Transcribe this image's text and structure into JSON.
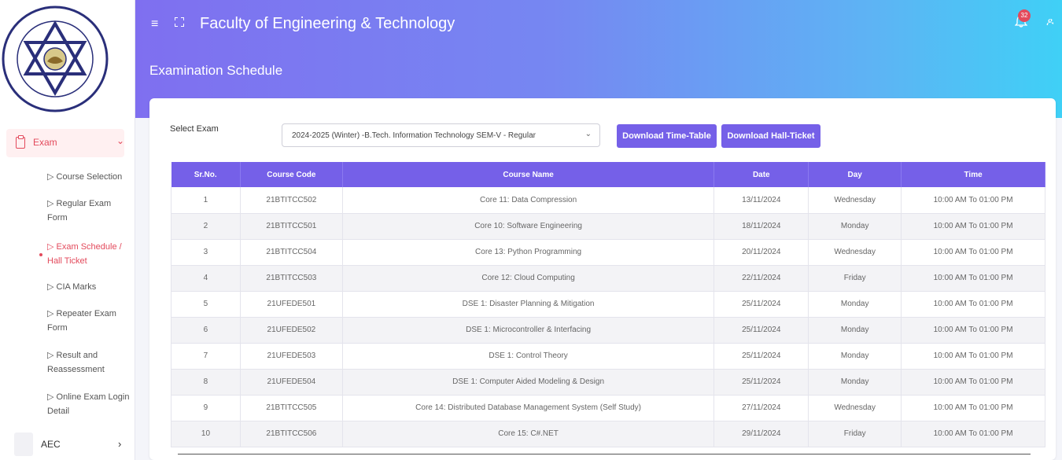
{
  "header": {
    "title": "Faculty of Engineering & Technology",
    "page_title": "Examination Schedule",
    "notification_count": "32"
  },
  "sidebar": {
    "exam_label": "Exam",
    "items": [
      {
        "label": "▷ Course Selection"
      },
      {
        "label": "▷ Regular Exam Form"
      },
      {
        "label": "▷ Exam Schedule / Hall Ticket"
      },
      {
        "label": "▷ CIA Marks"
      },
      {
        "label": "▷ Repeater Exam Form"
      },
      {
        "label": "▷ Result and Reassessment"
      },
      {
        "label": "▷ Online Exam Login Detail"
      }
    ],
    "aec_label": "AEC"
  },
  "filter": {
    "label": "Select Exam",
    "selected": "2024-2025 (Winter) -B.Tech. Information Technology SEM-V - Regular",
    "download_timetable": "Download Time-Table",
    "download_hallticket": "Download Hall-Ticket"
  },
  "table": {
    "headers": [
      "Sr.No.",
      "Course Code",
      "Course Name",
      "Date",
      "Day",
      "Time"
    ],
    "rows": [
      [
        "1",
        "21BTITCC502",
        "Core 11: Data Compression",
        "13/11/2024",
        "Wednesday",
        "10:00 AM To 01:00 PM"
      ],
      [
        "2",
        "21BTITCC501",
        "Core 10: Software Engineering",
        "18/11/2024",
        "Monday",
        "10:00 AM To 01:00 PM"
      ],
      [
        "3",
        "21BTITCC504",
        "Core 13: Python Programming",
        "20/11/2024",
        "Wednesday",
        "10:00 AM To 01:00 PM"
      ],
      [
        "4",
        "21BTITCC503",
        "Core 12: Cloud Computing",
        "22/11/2024",
        "Friday",
        "10:00 AM To 01:00 PM"
      ],
      [
        "5",
        "21UFEDE501",
        "DSE 1: Disaster Planning & Mitigation",
        "25/11/2024",
        "Monday",
        "10:00 AM To 01:00 PM"
      ],
      [
        "6",
        "21UFEDE502",
        "DSE 1: Microcontroller & Interfacing",
        "25/11/2024",
        "Monday",
        "10:00 AM To 01:00 PM"
      ],
      [
        "7",
        "21UFEDE503",
        "DSE 1: Control Theory",
        "25/11/2024",
        "Monday",
        "10:00 AM To 01:00 PM"
      ],
      [
        "8",
        "21UFEDE504",
        "DSE 1: Computer Aided Modeling & Design",
        "25/11/2024",
        "Monday",
        "10:00 AM To 01:00 PM"
      ],
      [
        "9",
        "21BTITCC505",
        "Core 14: Distributed Database Management System (Self Study)",
        "27/11/2024",
        "Wednesday",
        "10:00 AM To 01:00 PM"
      ],
      [
        "10",
        "21BTITCC506",
        "Core 15: C#.NET",
        "29/11/2024",
        "Friday",
        "10:00 AM To 01:00 PM"
      ]
    ]
  },
  "colors": {
    "accent": "#7560e8",
    "active": "#e34a5c"
  }
}
